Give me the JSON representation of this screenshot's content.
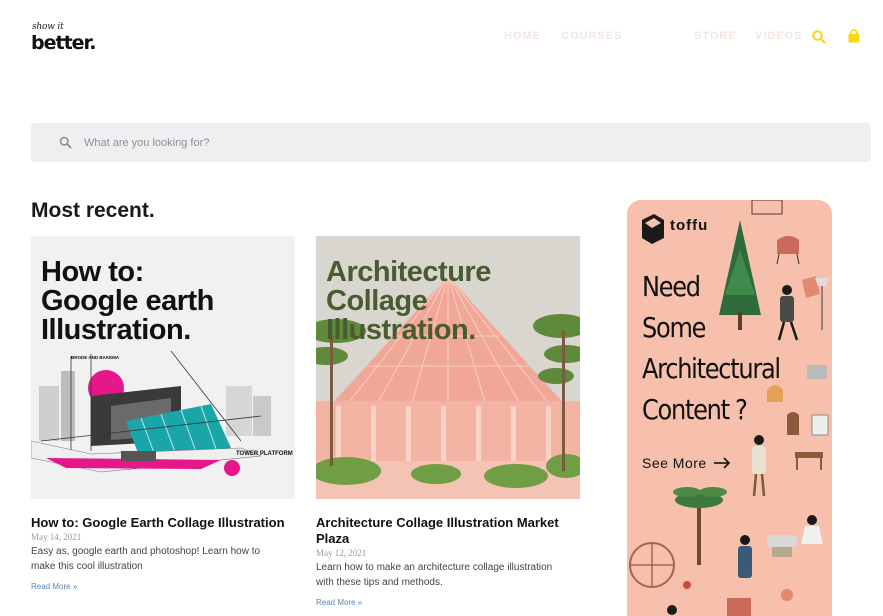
{
  "header": {
    "logo_small": "show it",
    "logo_big": "better.",
    "nav": {
      "home": "HOME",
      "courses": "COURSES",
      "store": "STORE",
      "videos": "VIDEOS"
    },
    "icons": [
      "search-icon",
      "shopping-bag-icon"
    ],
    "accent_color": "#f5d90a"
  },
  "search": {
    "placeholder": "What are you looking for?",
    "value": ""
  },
  "section": {
    "title": "Most recent."
  },
  "posts": [
    {
      "thumb_title_lines": [
        "How to:",
        "Google earth",
        "Illustration."
      ],
      "thumb_caption": "TOWER PLATFORM",
      "thumb_tag": "BRODE AND BAKEMA",
      "title": "How to: Google Earth Collage Illustration",
      "date": "May 14, 2021",
      "excerpt": "Easy as, google earth and photoshop! Learn how to make this cool illustration",
      "read_more": "Read More »"
    },
    {
      "thumb_title_lines": [
        "Architecture",
        "Collage",
        "Illustration."
      ],
      "title": "Architecture Collage Illustration Market Plaza",
      "date": "May 12, 2021",
      "excerpt": "Learn how to make an architecture collage illustration with these tips and methods.",
      "read_more": "Read More »"
    }
  ],
  "ad": {
    "brand": "toffu",
    "headline_lines": [
      "Need",
      "Some",
      "Architectural",
      "Content ?"
    ],
    "cta": "See More",
    "background_color": "#f6c0ad"
  }
}
